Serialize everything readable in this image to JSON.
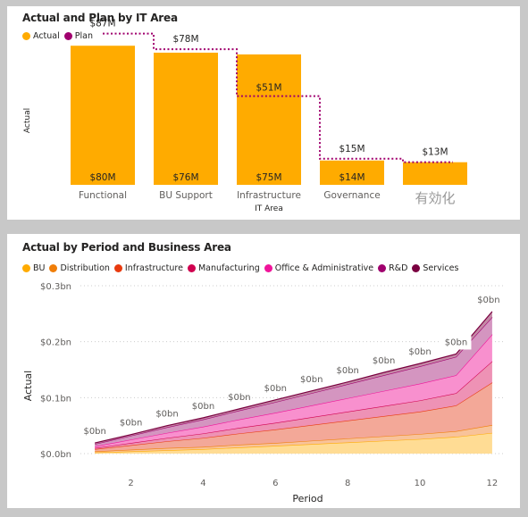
{
  "chart_data": [
    {
      "type": "bar",
      "title": "Actual and Plan by IT Area",
      "legend": [
        {
          "name": "Actual",
          "color": "#FFAB00"
        },
        {
          "name": "Plan",
          "color": "#A0006E"
        }
      ],
      "legend_position": "top-left",
      "xlabel": "IT Area",
      "ylabel": "Actual",
      "categories": [
        "Functional",
        "BU Support",
        "Infrastructure",
        "Governance",
        "有効化"
      ],
      "series": [
        {
          "name": "Actual",
          "type": "bar",
          "values": [
            80,
            76,
            75,
            14,
            13
          ],
          "labels": [
            "$80M",
            "$76M",
            "$75M",
            "$14M",
            ""
          ]
        },
        {
          "name": "Plan",
          "type": "step-line",
          "values": [
            87,
            78,
            51,
            15,
            13
          ],
          "labels": [
            "$87M",
            "$78M",
            "$51M",
            "$15M",
            "$13M"
          ]
        }
      ],
      "unit": "$M",
      "ylim": [
        0,
        95
      ]
    },
    {
      "type": "area",
      "stacked": true,
      "title": "Actual by Period and Business Area",
      "legend_position": "top-left",
      "xlabel": "Period",
      "ylabel": "Actual",
      "x": [
        1,
        2,
        3,
        4,
        5,
        6,
        7,
        8,
        9,
        10,
        11,
        12
      ],
      "xticks": [
        "2",
        "4",
        "6",
        "8",
        "10",
        "12"
      ],
      "xlim": [
        0.6,
        12.2
      ],
      "yticks": [
        "$0.0bn",
        "$0.1bn",
        "$0.2bn",
        "$0.3bn"
      ],
      "ylim": [
        0,
        0.3
      ],
      "grid": true,
      "total_labels": [
        "$0bn",
        "$0bn",
        "$0bn",
        "$0bn",
        "$0bn",
        "$0bn",
        "$0bn",
        "$0bn",
        "$0bn",
        "$0bn",
        "$0bn",
        "$0bn"
      ],
      "series": [
        {
          "name": "BU",
          "color": "#FFAB00",
          "fill": "#FFDC94",
          "values": [
            0.002,
            0.004,
            0.006,
            0.008,
            0.011,
            0.014,
            0.017,
            0.02,
            0.023,
            0.026,
            0.03,
            0.037
          ]
        },
        {
          "name": "Distribution",
          "color": "#F07E08",
          "fill": "#F8C39A",
          "values": [
            0.002,
            0.003,
            0.004,
            0.004,
            0.005,
            0.005,
            0.006,
            0.007,
            0.008,
            0.009,
            0.01,
            0.014
          ]
        },
        {
          "name": "Infrastructure",
          "color": "#E83A0E",
          "fill": "#F3A898",
          "values": [
            0.004,
            0.008,
            0.012,
            0.016,
            0.02,
            0.024,
            0.028,
            0.032,
            0.036,
            0.04,
            0.046,
            0.076
          ]
        },
        {
          "name": "Manufacturing",
          "color": "#D0004F",
          "fill": "#EE92B5",
          "values": [
            0.002,
            0.004,
            0.006,
            0.008,
            0.01,
            0.012,
            0.014,
            0.016,
            0.018,
            0.02,
            0.022,
            0.038
          ]
        },
        {
          "name": "Office & Administrative",
          "color": "#F0149A",
          "fill": "#F890CE",
          "values": [
            0.003,
            0.006,
            0.009,
            0.012,
            0.015,
            0.018,
            0.021,
            0.024,
            0.027,
            0.03,
            0.032,
            0.048
          ]
        },
        {
          "name": "R&D",
          "color": "#A0006E",
          "fill": "#D495C0",
          "values": [
            0.004,
            0.007,
            0.01,
            0.013,
            0.016,
            0.019,
            0.022,
            0.025,
            0.028,
            0.031,
            0.033,
            0.031
          ]
        },
        {
          "name": "Services",
          "color": "#7A0040",
          "fill": "#C48AA6",
          "values": [
            0.002,
            0.002,
            0.003,
            0.003,
            0.003,
            0.004,
            0.004,
            0.004,
            0.005,
            0.005,
            0.005,
            0.01
          ]
        }
      ]
    }
  ]
}
